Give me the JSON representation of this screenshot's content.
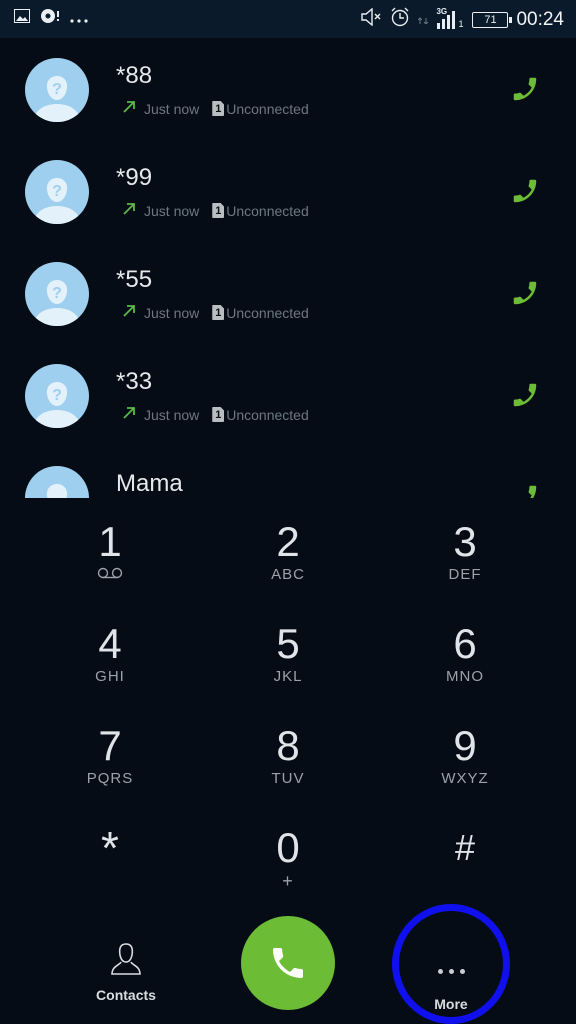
{
  "status_bar": {
    "left_icons": [
      "image-notification-icon",
      "sync-alert-icon",
      "more-notifications-icon"
    ],
    "right_icons": [
      "mute-icon",
      "alarm-icon",
      "data-arrows-icon",
      "signal-3g-icon",
      "battery-icon"
    ],
    "network": "3G",
    "sim_slot": "1",
    "battery_level": "71",
    "time": "00:24"
  },
  "call_log": [
    {
      "name": "*88",
      "direction": "outgoing",
      "time": "Just now",
      "sim": "1",
      "status": "Unconnected"
    },
    {
      "name": "*99",
      "direction": "outgoing",
      "time": "Just now",
      "sim": "1",
      "status": "Unconnected"
    },
    {
      "name": "*55",
      "direction": "outgoing",
      "time": "Just now",
      "sim": "1",
      "status": "Unconnected"
    },
    {
      "name": "*33",
      "direction": "outgoing",
      "time": "Just now",
      "sim": "1",
      "status": "Unconnected"
    },
    {
      "name": "Mama",
      "direction": "",
      "time": "",
      "sim": "",
      "status": ""
    }
  ],
  "keypad": [
    {
      "digit": "1",
      "letters": "",
      "icon": "voicemail-icon"
    },
    {
      "digit": "2",
      "letters": "ABC"
    },
    {
      "digit": "3",
      "letters": "DEF"
    },
    {
      "digit": "4",
      "letters": "GHI"
    },
    {
      "digit": "5",
      "letters": "JKL"
    },
    {
      "digit": "6",
      "letters": "MNO"
    },
    {
      "digit": "7",
      "letters": "PQRS"
    },
    {
      "digit": "8",
      "letters": "TUV"
    },
    {
      "digit": "9",
      "letters": "WXYZ"
    },
    {
      "digit": "*",
      "letters": ""
    },
    {
      "digit": "0",
      "letters": "+"
    },
    {
      "digit": "#",
      "letters": ""
    }
  ],
  "bottom_bar": {
    "contacts_label": "Contacts",
    "more_label": "More"
  },
  "colors": {
    "accent_green": "#6cbd35",
    "highlight_ring": "#1010ee",
    "background": "#050c15",
    "status_bar": "#0a1a2a"
  }
}
